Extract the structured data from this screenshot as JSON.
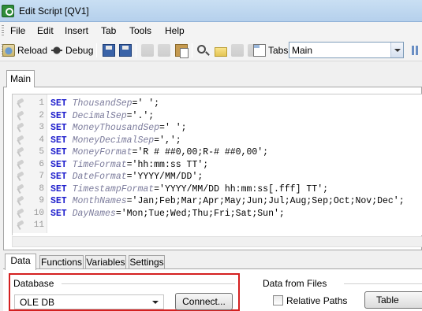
{
  "window": {
    "title": "Edit Script [QV1]"
  },
  "menu": [
    "File",
    "Edit",
    "Insert",
    "Tab",
    "Tools",
    "Help"
  ],
  "toolbar": {
    "reload_label": "Reload",
    "debug_label": "Debug",
    "tabs_label": "Tabs",
    "tab_select_value": "Main"
  },
  "editor": {
    "active_tab": "Main",
    "lines": [
      {
        "num": "1",
        "kw": "SET",
        "name": "ThousandSep",
        "value": "=' ';"
      },
      {
        "num": "2",
        "kw": "SET",
        "name": "DecimalSep",
        "value": "='.';"
      },
      {
        "num": "3",
        "kw": "SET",
        "name": "MoneyThousandSep",
        "value": "=' ';"
      },
      {
        "num": "4",
        "kw": "SET",
        "name": "MoneyDecimalSep",
        "value": "=',';"
      },
      {
        "num": "5",
        "kw": "SET",
        "name": "MoneyFormat",
        "value": "='R # ##0,00;R-# ##0,00';"
      },
      {
        "num": "6",
        "kw": "SET",
        "name": "TimeFormat",
        "value": "='hh:mm:ss TT';"
      },
      {
        "num": "7",
        "kw": "SET",
        "name": "DateFormat",
        "value": "='YYYY/MM/DD';"
      },
      {
        "num": "8",
        "kw": "SET",
        "name": "TimestampFormat",
        "value": "='YYYY/MM/DD hh:mm:ss[.fff] TT';"
      },
      {
        "num": "9",
        "kw": "SET",
        "name": "MonthNames",
        "value": "='Jan;Feb;Mar;Apr;May;Jun;Jul;Aug;Sep;Oct;Nov;Dec';"
      },
      {
        "num": "10",
        "kw": "SET",
        "name": "DayNames",
        "value": "='Mon;Tue;Wed;Thu;Fri;Sat;Sun';"
      },
      {
        "num": "11",
        "kw": "",
        "name": "",
        "value": ""
      }
    ]
  },
  "bottom_tabs": [
    "Data",
    "Functions",
    "Variables",
    "Settings"
  ],
  "data_panel": {
    "database_legend": "Database",
    "database_value": "OLE DB",
    "connect_label": "Connect...",
    "files_legend": "Data from Files",
    "relative_paths_label": "Relative Paths",
    "table_files_label": "Table Files..."
  }
}
